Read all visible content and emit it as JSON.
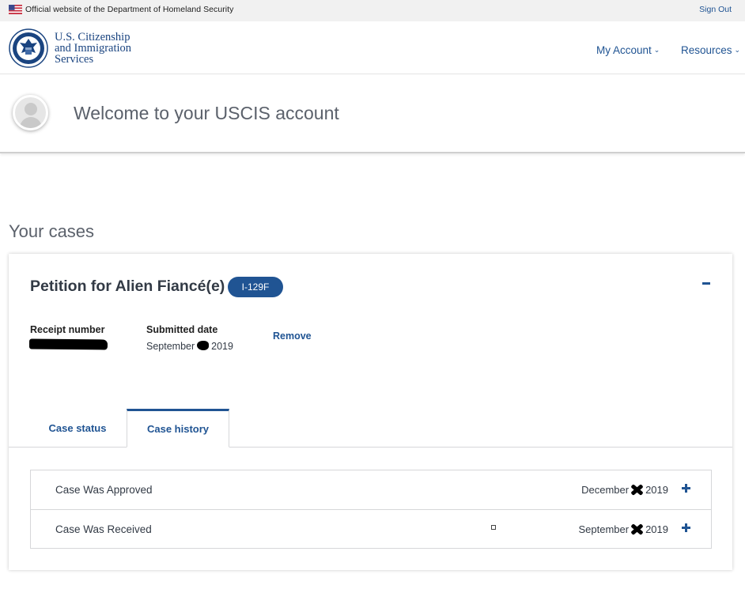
{
  "banner": {
    "official_text": "Official website of the Department of Homeland Security",
    "sign_out": "Sign Out"
  },
  "header": {
    "logo_line1": "U.S. Citizenship",
    "logo_line2": "and Immigration",
    "logo_line3": "Services",
    "nav": {
      "my_account": "My Account",
      "resources": "Resources"
    }
  },
  "welcome": {
    "title": "Welcome to your USCIS account"
  },
  "cases": {
    "heading": "Your cases",
    "case": {
      "title": "Petition for Alien Fiancé(e)",
      "form_badge": "I-129F",
      "receipt_label": "Receipt number",
      "submitted_label": "Submitted date",
      "submitted_month": "September",
      "submitted_year": "2019",
      "remove_label": "Remove",
      "tabs": {
        "status": "Case status",
        "history": "Case history"
      },
      "history": [
        {
          "label": "Case Was Approved",
          "month": "December",
          "year": "2019"
        },
        {
          "label": "Case Was Received",
          "month": "September",
          "year": "2019"
        }
      ]
    }
  },
  "colors": {
    "primary": "#205493",
    "text": "#323a45",
    "muted": "#5b616b"
  }
}
